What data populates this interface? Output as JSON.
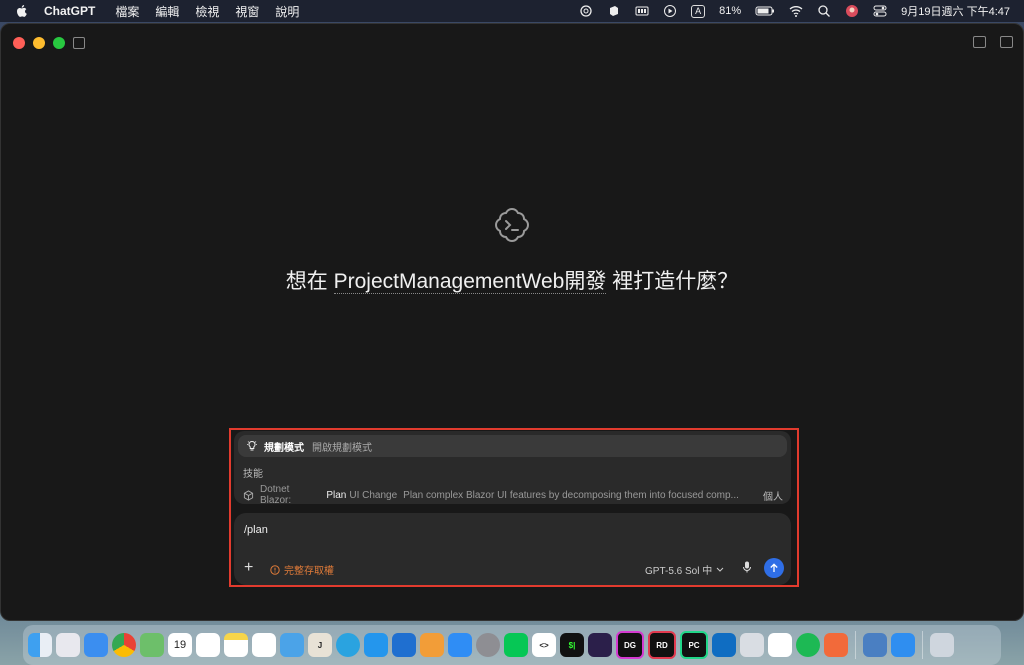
{
  "menubar": {
    "app_name": "ChatGPT",
    "items": [
      "檔案",
      "編輯",
      "檢視",
      "視窗",
      "說明"
    ],
    "input_indicator": "A",
    "battery": "81%",
    "datetime": "9月19日週六  下午4:47"
  },
  "main": {
    "title_prefix": "想在",
    "project": "ProjectManagementWeb開發",
    "title_suffix": "裡打造什麼？"
  },
  "suggestions": {
    "plan_mode_title": "規劃模式",
    "plan_mode_desc": "開啟規劃模式",
    "skills_label": "技能",
    "skill_prefix": "Dotnet Blazor:",
    "skill_plan": "Plan",
    "skill_suffix": "UI Change",
    "skill_desc": "Plan complex Blazor UI features by decomposing them into focused comp...",
    "skill_scope": "個人"
  },
  "composer": {
    "input_value": "/plan",
    "access_label": "完整存取權",
    "model_label": "GPT-5.6 Sol 中"
  },
  "colors": {
    "accent": "#2f6ee6",
    "warning": "#e07b39",
    "highlight": "#e23b2e"
  },
  "dock": {
    "calendar_day": "19",
    "apps": [
      "finder",
      "launchpad",
      "mail",
      "chrome",
      "maps",
      "calendar",
      "reminders",
      "notes",
      "freeform",
      "home",
      "j-app",
      "telegram",
      "docker",
      "bluetooth-app",
      "pages",
      "app-store",
      "system-settings",
      "line",
      "xcode-dev",
      "terminal",
      "obsidian",
      "datagrip",
      "rider",
      "pycharm",
      "vscode",
      "preview",
      "chatgpt",
      "spotify",
      "sketch",
      "downloads",
      "windows-app",
      "trash"
    ]
  }
}
